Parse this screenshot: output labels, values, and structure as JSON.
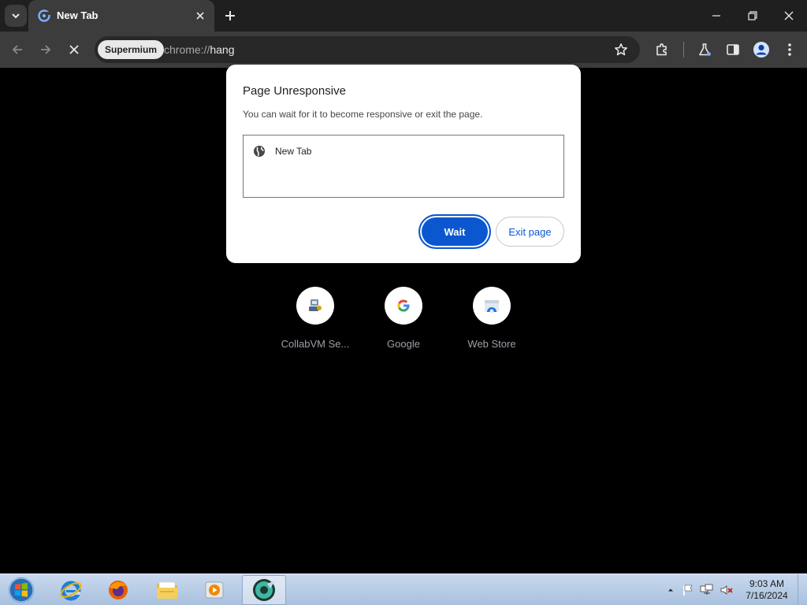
{
  "tabs": [
    {
      "title": "New Tab"
    }
  ],
  "toolbar": {
    "chip_label": "Supermium",
    "url_scheme": "chrome://",
    "url_host": "hang"
  },
  "shortcuts": [
    {
      "label": "CollabVM Se...",
      "icon": "collabvm-icon"
    },
    {
      "label": "Google",
      "icon": "google-icon"
    },
    {
      "label": "Web Store",
      "icon": "web-store-icon"
    }
  ],
  "dialog": {
    "title": "Page Unresponsive",
    "message": "You can wait for it to become responsive or exit the page.",
    "pages": [
      {
        "label": "New Tab",
        "icon": "globe-icon"
      }
    ],
    "wait_label": "Wait",
    "exit_label": "Exit page"
  },
  "taskbar": {
    "apps": [
      "start-orb",
      "internet-explorer-icon",
      "firefox-icon",
      "file-explorer-icon",
      "media-player-icon",
      "supermium-icon"
    ],
    "time": "9:03 AM",
    "date": "7/16/2024"
  },
  "colors": {
    "accent": "#0b57d0",
    "toolbar": "#3c3c3c",
    "titlebar": "#1f1f1f",
    "page_background": "#000000"
  }
}
